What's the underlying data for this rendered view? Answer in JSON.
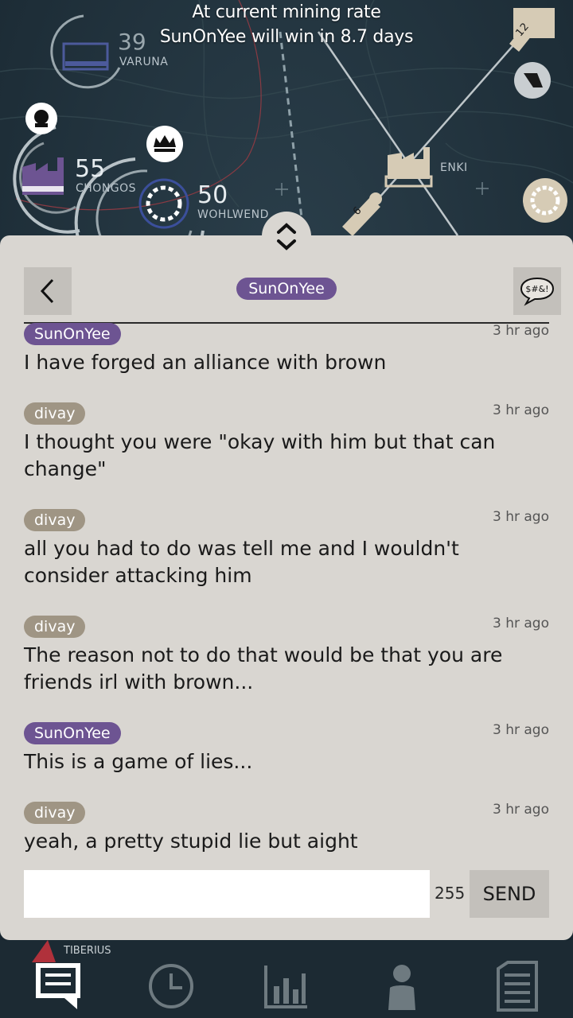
{
  "banner": {
    "line1": "At current mining rate",
    "line2": "SunOnYee will win in 8.7 days"
  },
  "map": {
    "stars": [
      {
        "name": "VARUNA",
        "value": "39"
      },
      {
        "name": "CHONGOS",
        "value": "55"
      },
      {
        "name": "WOHLWEND",
        "value": "50"
      },
      {
        "name": "ENKI",
        "value": ""
      },
      {
        "name": "TIBERIUS",
        "value": ""
      }
    ],
    "carriers": [
      "6",
      "12"
    ]
  },
  "chat": {
    "header_name": "SunOnYee",
    "censor_label": "$#&!",
    "messages": [
      {
        "author": "SunOnYee",
        "color": "purple",
        "time": "3 hr ago",
        "text": "I have forged an alliance with brown"
      },
      {
        "author": "divay",
        "color": "gray",
        "time": "3 hr ago",
        "text": "I thought you were \"okay with him but that can change\""
      },
      {
        "author": "divay",
        "color": "gray",
        "time": "3 hr ago",
        "text": "all you had to do was tell me and I wouldn't consider attacking him"
      },
      {
        "author": "divay",
        "color": "gray",
        "time": "3 hr ago",
        "text": "The reason not to do that would be that you are friends irl with brown..."
      },
      {
        "author": "SunOnYee",
        "color": "purple",
        "time": "3 hr ago",
        "text": "This is a game of lies..."
      },
      {
        "author": "divay",
        "color": "gray",
        "time": "3 hr ago",
        "text": "yeah, a pretty stupid lie but aight"
      }
    ],
    "input_value": "",
    "char_count": "255",
    "send_label": "SEND"
  },
  "colors": {
    "purple": "#6d5492",
    "gray": "#9f9584",
    "panel": "#d9d6d1",
    "button": "#c3c0bb"
  },
  "nav": {
    "items": [
      "chat-icon",
      "clock-icon",
      "bar-chart-icon",
      "person-icon",
      "document-icon"
    ]
  }
}
